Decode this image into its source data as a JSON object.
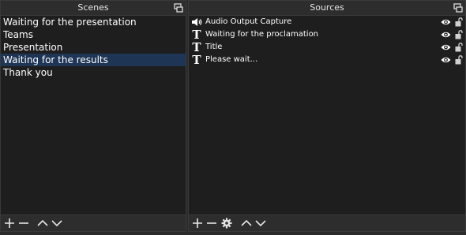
{
  "scenes": {
    "title": "Scenes",
    "items": [
      {
        "label": "Waiting for the presentation",
        "selected": false
      },
      {
        "label": "Teams",
        "selected": false
      },
      {
        "label": "Presentation",
        "selected": false
      },
      {
        "label": "Waiting for the results",
        "selected": true
      },
      {
        "label": "Thank you",
        "selected": false
      }
    ],
    "toolbar": [
      "plus-icon",
      "minus-icon",
      "chevron-up-icon",
      "chevron-down-icon"
    ]
  },
  "sources": {
    "title": "Sources",
    "items": [
      {
        "label": "Audio Output Capture",
        "icon": "speaker-icon",
        "visible": true,
        "locked": false
      },
      {
        "label": "Waiting for the proclamation",
        "icon": "text-icon",
        "visible": true,
        "locked": false
      },
      {
        "label": "Title",
        "icon": "text-icon",
        "visible": true,
        "locked": false
      },
      {
        "label": "Please wait...",
        "icon": "text-icon",
        "visible": true,
        "locked": false
      }
    ],
    "toolbar": [
      "plus-icon",
      "minus-icon",
      "gear-icon",
      "chevron-up-icon",
      "chevron-down-icon"
    ]
  },
  "colors": {
    "panel_bg": "#1e1e1e",
    "header_bg": "#2d2d2d",
    "selection": "#1e3555",
    "text": "#ffffff"
  }
}
